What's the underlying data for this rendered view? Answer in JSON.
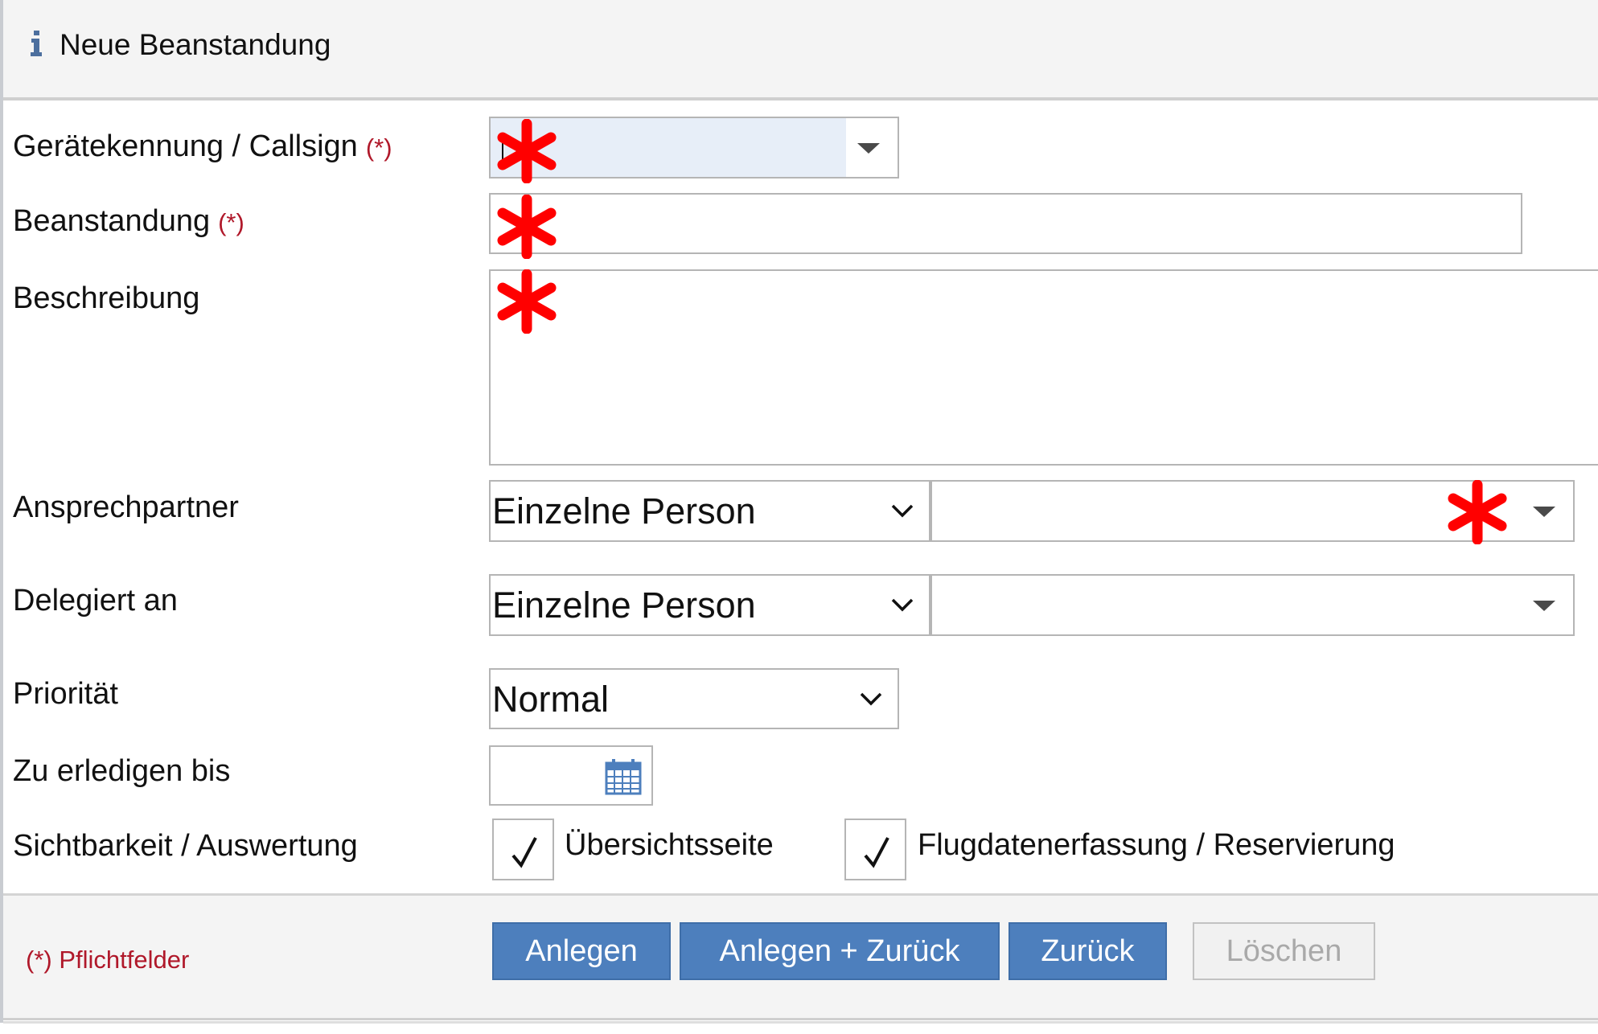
{
  "header": {
    "title": "Neue Beanstandung",
    "icon": "info-icon"
  },
  "required_marker": "(*)",
  "form": {
    "callsign": {
      "label": "Gerätekennung / Callsign",
      "required": true,
      "value": "",
      "type": "combobox"
    },
    "issue": {
      "label": "Beanstandung",
      "required": true,
      "value": ""
    },
    "description": {
      "label": "Beschreibung",
      "value": ""
    },
    "contact": {
      "label": "Ansprechpartner",
      "mode": "Einzelne Person",
      "person": ""
    },
    "delegated": {
      "label": "Delegiert an",
      "mode": "Einzelne Person",
      "person": ""
    },
    "priority": {
      "label": "Priorität",
      "value": "Normal"
    },
    "due_date": {
      "label": "Zu erledigen bis",
      "value": "",
      "icon": "calendar-icon"
    },
    "visibility": {
      "label": "Sichtbarkeit / Auswertung",
      "options": [
        {
          "label": "Übersichtsseite",
          "checked": true
        },
        {
          "label": "Flugdatenerfassung / Reservierung",
          "checked": true
        }
      ]
    }
  },
  "annotation": {
    "marker_symbol": "asterisk",
    "marker_color": "#ff0000"
  },
  "footer": {
    "required_note": "(*) Pflichtfelder",
    "buttons": {
      "create": "Anlegen",
      "create_back": "Anlegen + Zurück",
      "back": "Zurück",
      "delete": "Löschen"
    }
  },
  "colors": {
    "accent": "#4d7fbd",
    "required": "#b0182a",
    "focus_fill": "#e7eef8"
  }
}
